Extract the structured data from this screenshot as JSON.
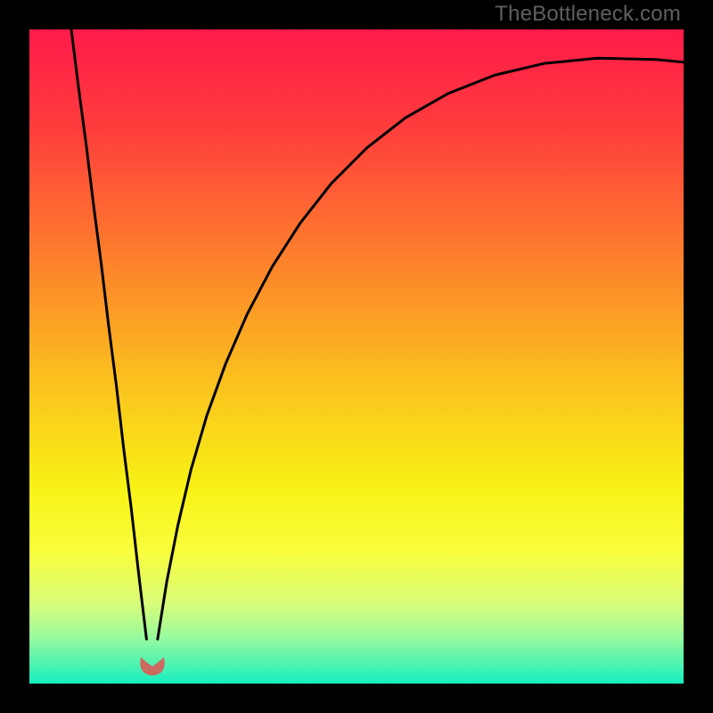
{
  "watermark": "TheBottleneck.com",
  "chart_data": {
    "type": "line",
    "title": "",
    "xlabel": "",
    "ylabel": "",
    "xlim": [
      0,
      100
    ],
    "ylim": [
      0,
      100
    ],
    "axes_visible": false,
    "legend": false,
    "background_gradient": {
      "stops": [
        {
          "offset": 0.0,
          "color": "#ff1a4a"
        },
        {
          "offset": 0.15,
          "color": "#ff3d3c"
        },
        {
          "offset": 0.34,
          "color": "#fd7c2d"
        },
        {
          "offset": 0.52,
          "color": "#fbbb1f"
        },
        {
          "offset": 0.7,
          "color": "#f8f215"
        },
        {
          "offset": 0.8,
          "color": "#f8fd3d"
        },
        {
          "offset": 0.88,
          "color": "#d7fc7b"
        },
        {
          "offset": 0.93,
          "color": "#97fa9e"
        },
        {
          "offset": 0.97,
          "color": "#4ff3b1"
        },
        {
          "offset": 1.0,
          "color": "#16eec0"
        }
      ]
    },
    "series": [
      {
        "name": "left-branch",
        "color": "#000000",
        "x": [
          6.4,
          7.5,
          8.7,
          9.8,
          11.0,
          12.1,
          13.3,
          14.4,
          15.6,
          16.7,
          17.9
        ],
        "y": [
          100.0,
          91.2,
          82.2,
          73.2,
          64.0,
          54.8,
          45.5,
          36.0,
          26.5,
          16.8,
          6.8
        ]
      },
      {
        "name": "right-branch",
        "color": "#000000",
        "x": [
          19.6,
          21.0,
          22.7,
          24.7,
          27.1,
          30.0,
          33.3,
          37.1,
          41.4,
          46.2,
          51.6,
          57.5,
          64.0,
          71.1,
          78.7,
          86.9,
          95.7,
          100.0
        ],
        "y": [
          6.8,
          15.6,
          24.2,
          32.7,
          40.9,
          48.9,
          56.5,
          63.7,
          70.4,
          76.5,
          81.9,
          86.5,
          90.2,
          93.0,
          94.8,
          95.6,
          95.4,
          95.0
        ]
      }
    ],
    "marker": {
      "name": "valley-marker",
      "x": 18.8,
      "y": 3.0,
      "color": "#cc6a60",
      "shape": "blob"
    }
  }
}
